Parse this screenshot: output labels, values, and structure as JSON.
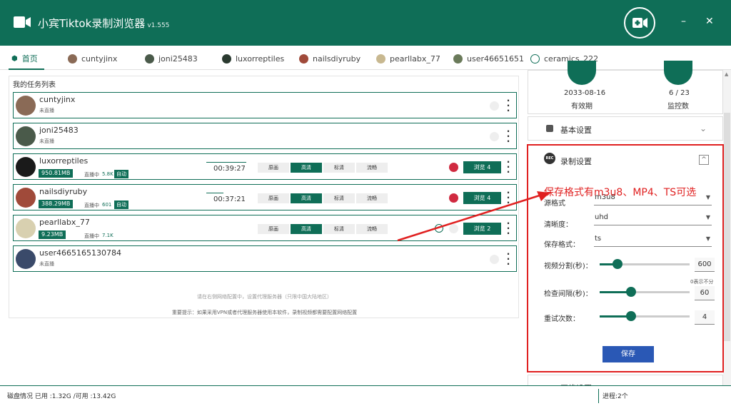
{
  "app": {
    "title": "小宾Tiktok录制浏览器",
    "version": "v1.555"
  },
  "tabs": [
    {
      "label": "首页"
    },
    {
      "label": "cuntyjinx"
    },
    {
      "label": "joni25483"
    },
    {
      "label": "luxorreptiles"
    },
    {
      "label": "nailsdiyruby"
    },
    {
      "label": "pearllabx_77"
    },
    {
      "label": "user46651651"
    },
    {
      "label": "ceramics_222"
    }
  ],
  "task_list": {
    "title": "我的任务列表",
    "quality_labels": [
      "原画",
      "高清",
      "标清",
      "流畅"
    ],
    "tasks": [
      {
        "name": "cuntyjinx",
        "status": "未直播"
      },
      {
        "name": "joni25483",
        "status": "未直播"
      },
      {
        "name": "luxorreptiles",
        "size": "950.81MB",
        "recording_label": "直播中",
        "viewers": "5.8K",
        "auto": "自动",
        "time": "00:39:27",
        "browse": "浏览 4"
      },
      {
        "name": "nailsdiyruby",
        "size": "388.29MB",
        "recording_label": "直播中",
        "viewers": "601",
        "auto": "自动",
        "time": "00:37:21",
        "browse": "浏览 4"
      },
      {
        "name": "pearllabx_77",
        "size": "9.23MB",
        "recording_label": "直播中",
        "viewers": "7.1K",
        "browse": "浏览 2"
      },
      {
        "name": "user4665165130784",
        "status": "未直播"
      }
    ],
    "hint_network": "请在右侧网络配置中，设置代理服务器（只限中国大陆地区）",
    "hint_important": "重要提示：如果采用VPN或者代理服务器使用本软件，录制视频都需要配置网络配置"
  },
  "stats": {
    "expiry_date": "2033-08-16",
    "expiry_label": "有效期",
    "monitor_count": "6 / 23",
    "monitor_label": "监控数"
  },
  "basic_settings": {
    "title": "基本设置"
  },
  "record_settings": {
    "icon_text": "REC",
    "title": "录制设置",
    "annotation": "保存格式有m3u8、MP4、TS可选",
    "source_format": {
      "label": "源格式",
      "value": "m3u8"
    },
    "resolution": {
      "label": "清晰度：",
      "value": "uhd"
    },
    "save_format": {
      "label": "保存格式：",
      "value": "ts"
    },
    "video_split": {
      "label": "视频分割(秒)：",
      "value": "600",
      "level": 0.2
    },
    "check_interval": {
      "label": "检查间隔(秒)：",
      "value": "60",
      "note": "0表示不分",
      "level": 0.35
    },
    "retry_count": {
      "label": "重试次数：",
      "value": "4",
      "level": 0.35
    },
    "save_button": "保存"
  },
  "network_settings": {
    "title": "网络设置"
  },
  "footer": {
    "disk": "磁盘情况 已用 :1.32G /可用 :13.42G",
    "processes": "进程:2个"
  },
  "colors": {
    "primary": "#0f6e57",
    "annotation": "#e02020",
    "save_button": "#2a58b5"
  }
}
